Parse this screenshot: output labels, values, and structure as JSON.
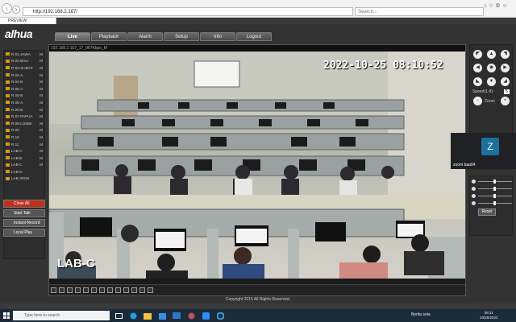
{
  "browser": {
    "address": "http://192.168.2.167/",
    "search_placeholder": "Search...",
    "tab_title": "PREVIEW"
  },
  "app": {
    "logo": "alhua",
    "tabs": [
      "Live",
      "Playback",
      "Alarm",
      "Setup",
      "Info",
      "Logout"
    ],
    "active_tab": "Live",
    "footer": "Copyright 2015 All Rights Reserved."
  },
  "sidebar": {
    "cameras": [
      {
        "label": "R.01-JAWA",
        "m": "M"
      },
      {
        "label": "R.02-BALI",
        "m": "M"
      },
      {
        "label": "R.03-SUMAT",
        "m": "M"
      },
      {
        "label": "R.04-A",
        "m": "M"
      },
      {
        "label": "R.04-B",
        "m": "M"
      },
      {
        "label": "R.05-A",
        "m": "M"
      },
      {
        "label": "R.05-B",
        "m": "M"
      },
      {
        "label": "R.06-A",
        "m": "M"
      },
      {
        "label": "R.06-B",
        "m": "M"
      },
      {
        "label": "R.07-PAPUA",
        "m": "M"
      },
      {
        "label": "R.08-LOMBI",
        "m": "M"
      },
      {
        "label": "R.09",
        "m": "M"
      },
      {
        "label": "R.10",
        "m": "M"
      },
      {
        "label": "R.11",
        "m": "M"
      },
      {
        "label": "LAB-A",
        "m": "M"
      },
      {
        "label": "LAB-B",
        "m": "M"
      },
      {
        "label": "LAB-C",
        "m": "M"
      },
      {
        "label": "LAB-D",
        "m": ""
      },
      {
        "label": "LAB-JRSN",
        "m": ""
      }
    ],
    "buttons": [
      "Close All",
      "Start Talk",
      "Instant Record",
      "Local Play"
    ]
  },
  "video": {
    "header": "192.168.2.167_17_967Kbps_M",
    "timestamp": "2022-10-25 08:10:52",
    "channel_name": "LAB-C"
  },
  "ptz": {
    "speed_label": "Speed(1-8):",
    "speed_value": "5",
    "zoom_label": "Zoom",
    "reset_label": "Reset"
  },
  "zoom_tile": {
    "initial": "Z",
    "name": "zoom baa04"
  },
  "taskbar": {
    "search_placeholder": "Type here to search",
    "weather": "Berita sela",
    "time": "08:11",
    "date": "10/25/2022"
  }
}
